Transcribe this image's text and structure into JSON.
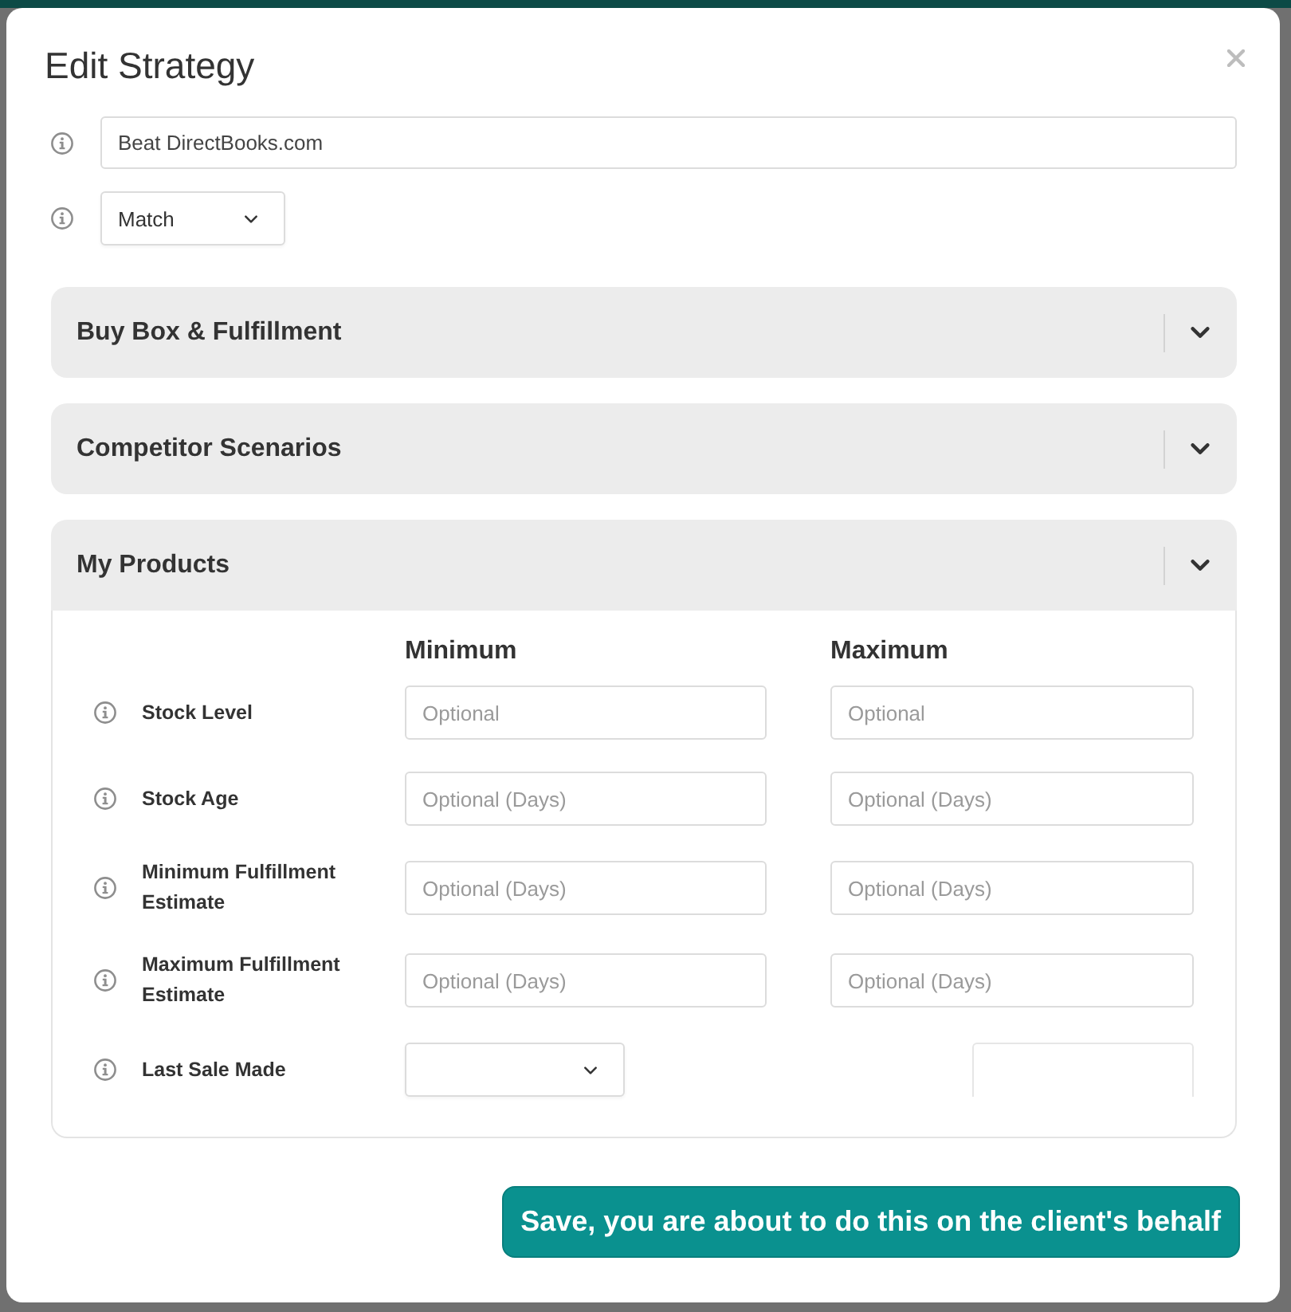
{
  "dialog": {
    "title": "Edit Strategy"
  },
  "fields": [
    {
      "kind": "text",
      "value": "Beat DirectBooks.com"
    },
    {
      "kind": "select",
      "value": "Match"
    }
  ],
  "sections": [
    {
      "title": "Buy Box & Fulfillment",
      "expanded": false
    },
    {
      "title": "Competitor Scenarios",
      "expanded": false
    },
    {
      "title": "My Products",
      "expanded": true,
      "columns": [
        "Minimum",
        "Maximum"
      ],
      "rows": [
        {
          "label": "Stock Level",
          "inputs": [
            {
              "kind": "text",
              "placeholder": "Optional"
            },
            {
              "kind": "text",
              "placeholder": "Optional"
            }
          ]
        },
        {
          "label": "Stock Age",
          "inputs": [
            {
              "kind": "text",
              "placeholder": "Optional (Days)"
            },
            {
              "kind": "text",
              "placeholder": "Optional (Days)"
            }
          ]
        },
        {
          "label": "Minimum Fulfillment Estimate",
          "inputs": [
            {
              "kind": "text",
              "placeholder": "Optional (Days)"
            },
            {
              "kind": "text",
              "placeholder": "Optional (Days)"
            }
          ]
        },
        {
          "label": "Maximum Fulfillment Estimate",
          "inputs": [
            {
              "kind": "text",
              "placeholder": "Optional (Days)"
            },
            {
              "kind": "text",
              "placeholder": "Optional (Days)"
            }
          ]
        },
        {
          "label": "Last Sale Made",
          "inputs": [
            {
              "kind": "select"
            },
            {
              "kind": "partial"
            }
          ]
        }
      ]
    }
  ],
  "save_button": {
    "label": "Save, you are about to do this on the client's behalf"
  }
}
